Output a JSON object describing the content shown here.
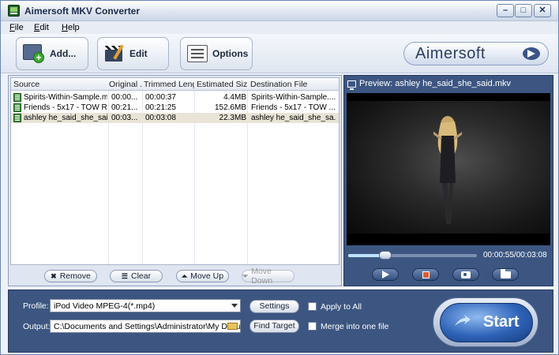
{
  "window": {
    "title": "Aimersoft MKV Converter",
    "controls": {
      "minimize": "–",
      "maximize": "□",
      "close": "✕"
    }
  },
  "menu": {
    "items": [
      "File",
      "Edit",
      "Help"
    ]
  },
  "toolbar": {
    "add_label": "Add...",
    "edit_label": "Edit",
    "options_label": "Options",
    "logo_text": "Aimersoft"
  },
  "file_list": {
    "columns": [
      "Source",
      "Original ...",
      "Trimmed Length",
      "Estimated Size",
      "Destination File"
    ],
    "rows": [
      {
        "source": "Spirits-Within-Sample.mkv",
        "original": "00:00...",
        "trimmed": "00:00:37",
        "size": "4.4MB",
        "destination": "Spirits-Within-Sample...."
      },
      {
        "source": "Friends - 5x17 - TOW R...",
        "original": "00:21...",
        "trimmed": "00:21:25",
        "size": "152.6MB",
        "destination": "Friends - 5x17 - TOW ..."
      },
      {
        "source": "ashley he_said_she_sai...",
        "original": "00:03...",
        "trimmed": "00:03:08",
        "size": "22.3MB",
        "destination": "ashley he_said_she_sa..."
      }
    ],
    "selected_index": 2,
    "buttons": {
      "remove": "Remove",
      "clear": "Clear",
      "move_up": "Move Up",
      "move_down": "Move Down"
    }
  },
  "preview": {
    "title": "Preview: ashley he_said_she_said.mkv",
    "time": "00:00:55/00:03:08",
    "progress_fraction": 0.29
  },
  "bottom": {
    "profile_label": "Profile:",
    "profile_value": "iPod Video MPEG-4(*.mp4)",
    "output_label": "Output:",
    "output_value": "C:\\Documents and Settings\\Administrator\\My Documen",
    "settings_label": "Settings",
    "find_target_label": "Find Target",
    "apply_to_all_label": "Apply to All",
    "merge_label": "Merge into one file",
    "start_label": "Start"
  },
  "colors": {
    "panel_blue": "#3c5681",
    "accent_blue": "#2e63b7",
    "selection": "#e9e4d7"
  }
}
